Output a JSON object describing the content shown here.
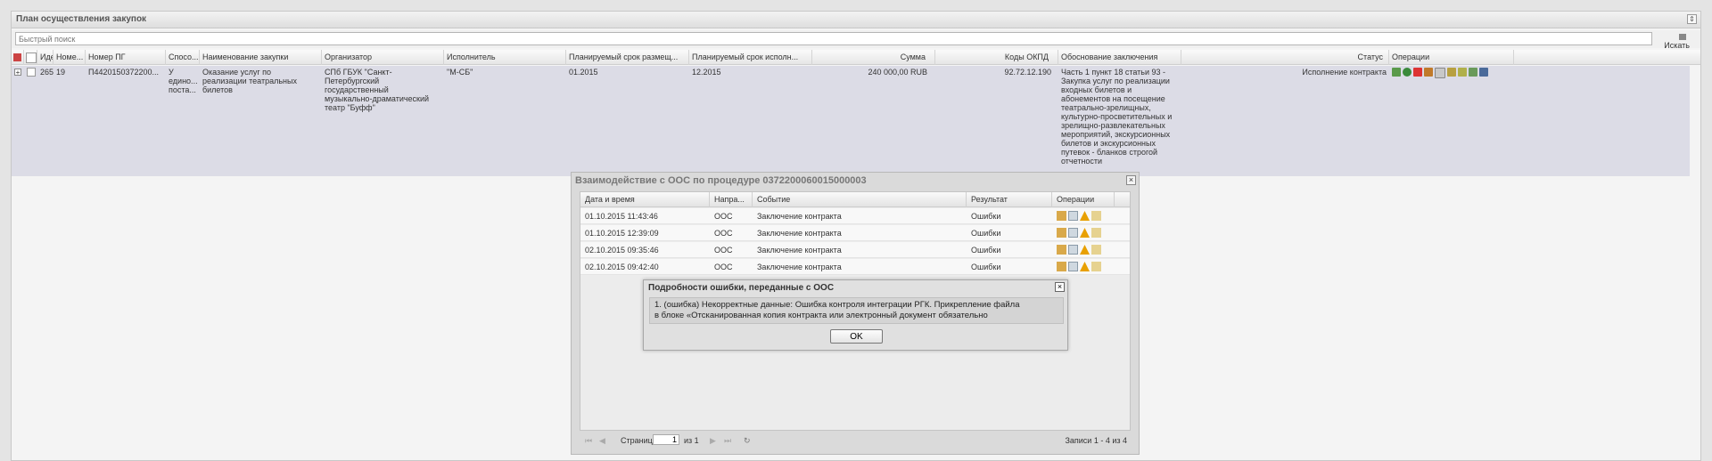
{
  "panel": {
    "title": "План осуществления закупок"
  },
  "search": {
    "placeholder": "Быстрый поиск",
    "button_label": "Искать"
  },
  "grid": {
    "columns": [
      "Иде",
      "Номе...",
      "Номер ПГ",
      "Спосо...",
      "Наименование закупки",
      "Организатор",
      "Исполнитель",
      "Планируемый срок размещ...",
      "Планируемый срок исполн...",
      "Сумма",
      "Коды ОКПД",
      "Обоснование заключения",
      "Статус",
      "Операции"
    ],
    "row": {
      "id": "265",
      "num": "19",
      "pg_num": "П4420150372200...",
      "method": "У едино... поста...",
      "name": "Оказание услуг по реализации театральных билетов",
      "organizer": "СПб ГБУК \"Санкт-Петербургский государственный музыкально-драматический театр \"Буфф\"",
      "executor": "\"М-СБ\"",
      "plan_place": "01.2015",
      "plan_exec": "12.2015",
      "sum": "240 000,00 RUB",
      "okpd": "92.72.12.190",
      "basis": "Часть 1 пункт 18 статьи 93 - Закупка услуг по реализации входных билетов и абонементов на посещение театрально-зрелищных, культурно-просветительных и зрелищно-развлекательных мероприятий, экскурсионных билетов и экскурсионных путевок - бланков строгой отчетности",
      "status": "Исполнение контракта"
    }
  },
  "dialog": {
    "title": "Взаимодействие с ООС по процедуре 0372200060015000003",
    "columns": [
      "Дата и время",
      "Напра...",
      "Событие",
      "Результат",
      "Операции"
    ],
    "rows": [
      {
        "datetime": "01.10.2015 11:43:46",
        "direction": "ООС",
        "event": "Заключение контракта",
        "result": "Ошибки"
      },
      {
        "datetime": "01.10.2015 12:39:09",
        "direction": "ООС",
        "event": "Заключение контракта",
        "result": "Ошибки"
      },
      {
        "datetime": "02.10.2015 09:35:46",
        "direction": "ООС",
        "event": "Заключение контракта",
        "result": "Ошибки"
      },
      {
        "datetime": "02.10.2015 09:42:40",
        "direction": "ООС",
        "event": "Заключение контракта",
        "result": "Ошибки"
      }
    ],
    "pager": {
      "page_label": "Страница",
      "page": "1",
      "of_label": "из 1",
      "records": "Записи 1 - 4 из 4"
    }
  },
  "error_dialog": {
    "title": "Подробности ошибки, переданные с ООС",
    "message_line1": "1. (ошибка) Некорректные данные: Ошибка контроля интеграции РГК. Прикрепление файла",
    "message_line2": "в блоке «Отсканированная копия контракта или электронный документ обязательно",
    "ok_label": "OK"
  },
  "colors": {
    "row_selected": "#dcdce6",
    "header_bg": "#e6e6e6",
    "warning": "#e8a000"
  }
}
